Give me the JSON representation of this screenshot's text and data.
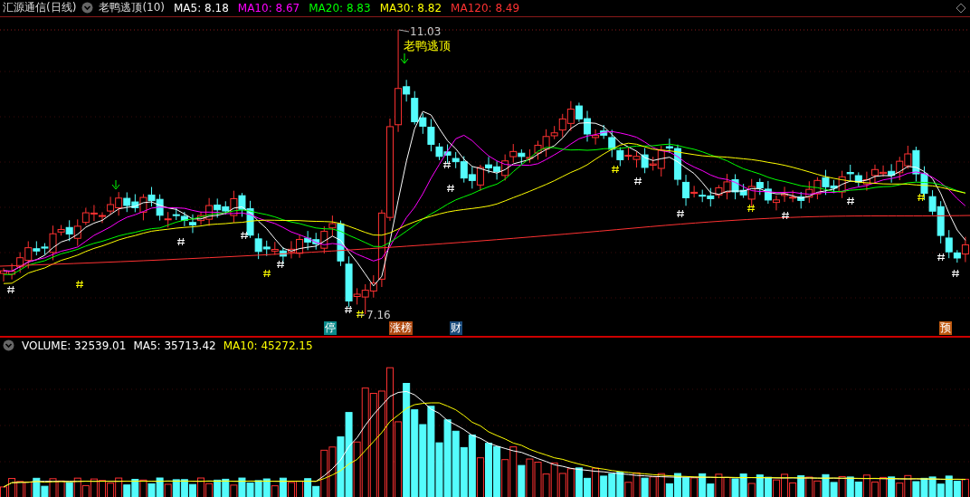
{
  "header": {
    "title": "汇源通信(日线)",
    "indicator": "老鸭逃顶(10)",
    "ma_labels": [
      {
        "text": "MA5: 8.18",
        "color": "#ffffff"
      },
      {
        "text": "MA10: 8.67",
        "color": "#ff00ff"
      },
      {
        "text": "MA20: 8.83",
        "color": "#00ff00"
      },
      {
        "text": "MA30: 8.82",
        "color": "#ffff00"
      },
      {
        "text": "MA120: 8.49",
        "color": "#ff3232"
      }
    ]
  },
  "annotations": {
    "high": "11.03",
    "low": "7.16",
    "signal": "老鸭逃顶"
  },
  "badges": [
    {
      "text": "停",
      "color": "#0a8a8a"
    },
    {
      "text": "涨榜",
      "color": "#b04a10"
    },
    {
      "text": "财",
      "color": "#1a4a7a"
    },
    {
      "text": "预",
      "color": "#c05a10"
    }
  ],
  "volume_header": {
    "labels": [
      {
        "text": "VOLUME: 32539.01",
        "color": "#ffffff"
      },
      {
        "text": "MA5: 35713.42",
        "color": "#ffffff"
      },
      {
        "text": "MA10: 45272.15",
        "color": "#ffff00"
      }
    ]
  }
}
